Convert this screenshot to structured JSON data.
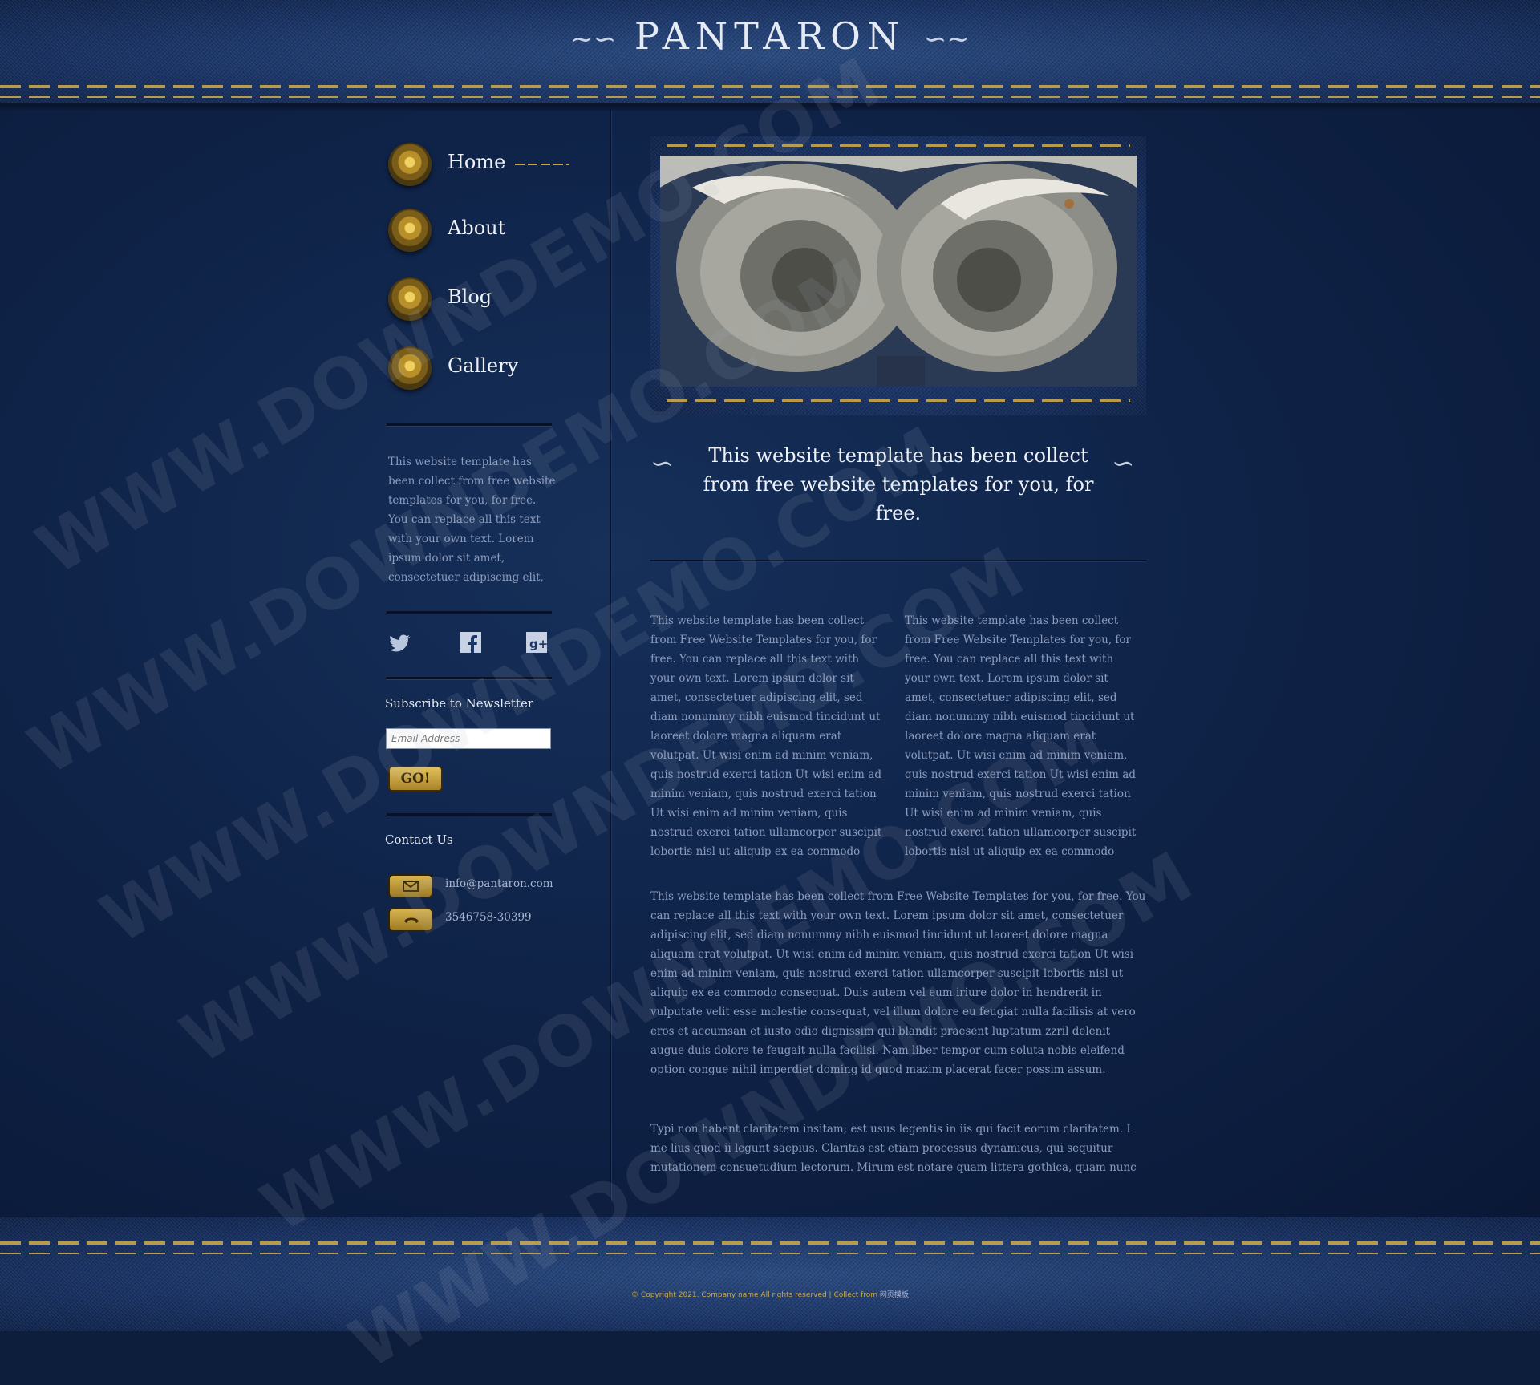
{
  "site": {
    "logo": "PANTARON",
    "swirl_left": "~",
    "swirl_right": "~"
  },
  "nav": [
    {
      "label": "Home",
      "active": true
    },
    {
      "label": "About"
    },
    {
      "label": "Blog"
    },
    {
      "label": "Gallery"
    }
  ],
  "sidebar": {
    "intro": "This website template has been collect from free website templates for you, for free. You can replace all this text with your own text. Lorem ipsum dolor sit amet, consectetuer adipiscing elit,",
    "social": [
      "twitter-icon",
      "facebook-icon",
      "google-plus-icon"
    ],
    "newsletter_title": "Subscribe to Newsletter",
    "email_placeholder": "Email Address",
    "go_label": "GO!",
    "contact_title": "Contact Us",
    "email": "info@pantaron.com",
    "phone": "3546758-30399"
  },
  "main": {
    "tagline": "This website template has been collect from free website templates for you, for free.",
    "col1": "This website template has been collect from Free Website Templates for you, for free. You can replace all this text with your own text. Lorem ipsum dolor sit amet, consectetuer adipiscing elit, sed diam nonummy nibh euismod tincidunt ut laoreet dolore magna aliquam erat volutpat. Ut wisi enim ad minim veniam, quis nostrud exerci tation Ut wisi enim ad minim veniam, quis nostrud exerci tation Ut wisi enim ad minim veniam, quis nostrud exerci tation ullamcorper suscipit lobortis nisl ut aliquip ex ea commodo",
    "col2": "This website template has been collect from Free Website Templates for you, for free. You can replace all this text with your own text. Lorem ipsum dolor sit amet, consectetuer adipiscing elit, sed diam nonummy nibh euismod tincidunt ut laoreet dolore magna aliquam erat volutpat. Ut wisi enim ad minim veniam, quis nostrud exerci tation Ut wisi enim ad minim veniam, quis nostrud exerci tation Ut wisi enim ad minim veniam, quis nostrud exerci tation ullamcorper suscipit lobortis nisl ut aliquip ex ea commodo",
    "para1": "This website template has been collect from Free Website Templates for you, for free. You can replace all this text with your own text. Lorem ipsum dolor sit amet, consectetuer adipiscing elit, sed diam nonummy nibh euismod tincidunt ut laoreet dolore magna aliquam erat volutpat. Ut wisi enim ad minim veniam, quis nostrud exerci tation Ut wisi enim ad minim veniam, quis nostrud exerci tation ullamcorper suscipit lobortis nisl ut aliquip ex ea commodo consequat. Duis autem vel eum iriure dolor in hendrerit in vulputate velit esse molestie consequat, vel illum dolore eu feugiat nulla facilisis at vero eros et accumsan et iusto odio dignissim qui blandit praesent luptatum zzril delenit augue duis dolore te feugait nulla facilisi. Nam liber tempor cum soluta nobis eleifend option congue nihil imperdiet doming id quod mazim placerat facer possim assum.",
    "para2": "Typi non habent claritatem insitam; est usus legentis in iis qui facit eorum claritatem. I me lius quod ii legunt saepius. Claritas est etiam processus dynamicus, qui sequitur mutationem consuetudium lectorum. Mirum est notare quam littera gothica, quam nunc"
  },
  "footer": {
    "text": "© Copyright 2021. Company name All rights reserved | Collect from ",
    "link": "网页模板"
  },
  "watermark": "WWW.DOWNDEMO.COM",
  "colors": {
    "accent": "#c9a64a",
    "denim": "#1b3766",
    "background": "#0d1d3c"
  }
}
